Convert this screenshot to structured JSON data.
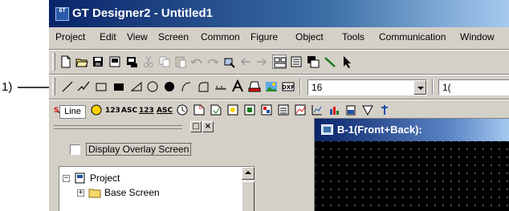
{
  "window": {
    "title": "GT Designer2 - Untitled1"
  },
  "menubar": [
    "Project",
    "Edit",
    "View",
    "Screen",
    "Common",
    "Figure",
    "Object",
    "Tools",
    "Communication",
    "Window"
  ],
  "toolbar_standard": {
    "icons": [
      "new-document-icon",
      "open-folder-icon",
      "save-icon",
      "screen-icon",
      "screen-save-icon",
      "cut-icon",
      "copy-icon",
      "paste-icon",
      "undo-icon",
      "redo-icon",
      "find-icon",
      "back-icon",
      "forward-icon",
      "screen-list-icon",
      "properties-icon",
      "duplicate-icon",
      "wand-icon",
      "select-arrow-icon"
    ]
  },
  "toolbar_figure": {
    "icons": [
      "line-icon",
      "polyline-icon",
      "rectangle-icon",
      "filled-rectangle-icon",
      "polygon-icon",
      "circle-icon",
      "filled-circle-icon",
      "arc-icon",
      "sector-icon",
      "scale-icon",
      "text-icon",
      "paint-icon",
      "bitmap-icon",
      "dxf-icon"
    ],
    "font_size": "16",
    "font_size_2": "1("
  },
  "toolbar_object": {
    "line_label": "Line",
    "labels": [
      "123",
      "ASC",
      "123",
      "ASC"
    ]
  },
  "left_panel": {
    "checkbox_label": "Display Overlay Screen",
    "checkbox_checked": false,
    "tree": [
      {
        "label": "Project",
        "expanded": true
      },
      {
        "label": "Base Screen",
        "expanded": false
      }
    ]
  },
  "screen_window": {
    "title": "B-1(Front+Back):"
  },
  "callout": {
    "label": "1)"
  }
}
